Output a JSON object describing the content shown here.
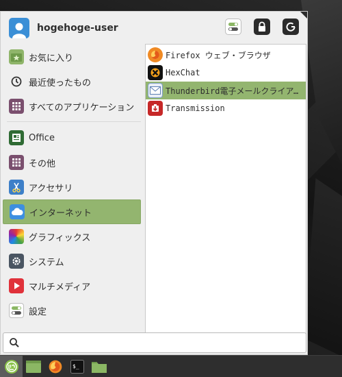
{
  "user": {
    "name": "hogehoge-user",
    "avatar_icon": "user-avatar-icon"
  },
  "top_buttons": [
    {
      "name": "settings-toggle-icon",
      "tooltip": ""
    },
    {
      "name": "lock-icon"
    },
    {
      "name": "power-icon"
    }
  ],
  "categories": [
    {
      "label": "お気に入り",
      "icon": "favorites-icon"
    },
    {
      "label": "最近使ったもの",
      "icon": "recent-clock-icon"
    },
    {
      "label": "すべてのアプリケーション",
      "icon": "all-apps-grid-icon"
    },
    {
      "label": "Office",
      "icon": "office-icon"
    },
    {
      "label": "その他",
      "icon": "other-grid-icon"
    },
    {
      "label": "アクセサリ",
      "icon": "accessories-scissors-icon"
    },
    {
      "label": "インターネット",
      "icon": "internet-cloud-icon",
      "active": true
    },
    {
      "label": "グラフィックス",
      "icon": "graphics-icon"
    },
    {
      "label": "システム",
      "icon": "system-gear-icon"
    },
    {
      "label": "マルチメディア",
      "icon": "multimedia-play-icon"
    },
    {
      "label": "設定",
      "icon": "settings-toggle-icon"
    }
  ],
  "apps": [
    {
      "label": "Firefox ウェブ・ブラウザ",
      "icon": "firefox-icon"
    },
    {
      "label": "HexChat",
      "icon": "hexchat-icon"
    },
    {
      "label": "Thunderbird電子メールクライアント",
      "icon": "thunderbird-mail-icon",
      "selected": true
    },
    {
      "label": "Transmission",
      "icon": "transmission-icon"
    }
  ],
  "search": {
    "value": "",
    "placeholder": ""
  },
  "taskbar": [
    {
      "name": "mint-menu-icon"
    },
    {
      "name": "show-desktop-folder-icon"
    },
    {
      "name": "firefox-icon"
    },
    {
      "name": "terminal-icon"
    },
    {
      "name": "files-folder-icon"
    }
  ],
  "colors": {
    "accent": "#93b56f",
    "menu_bg": "#efefef",
    "taskbar": "#2e2e2e"
  }
}
